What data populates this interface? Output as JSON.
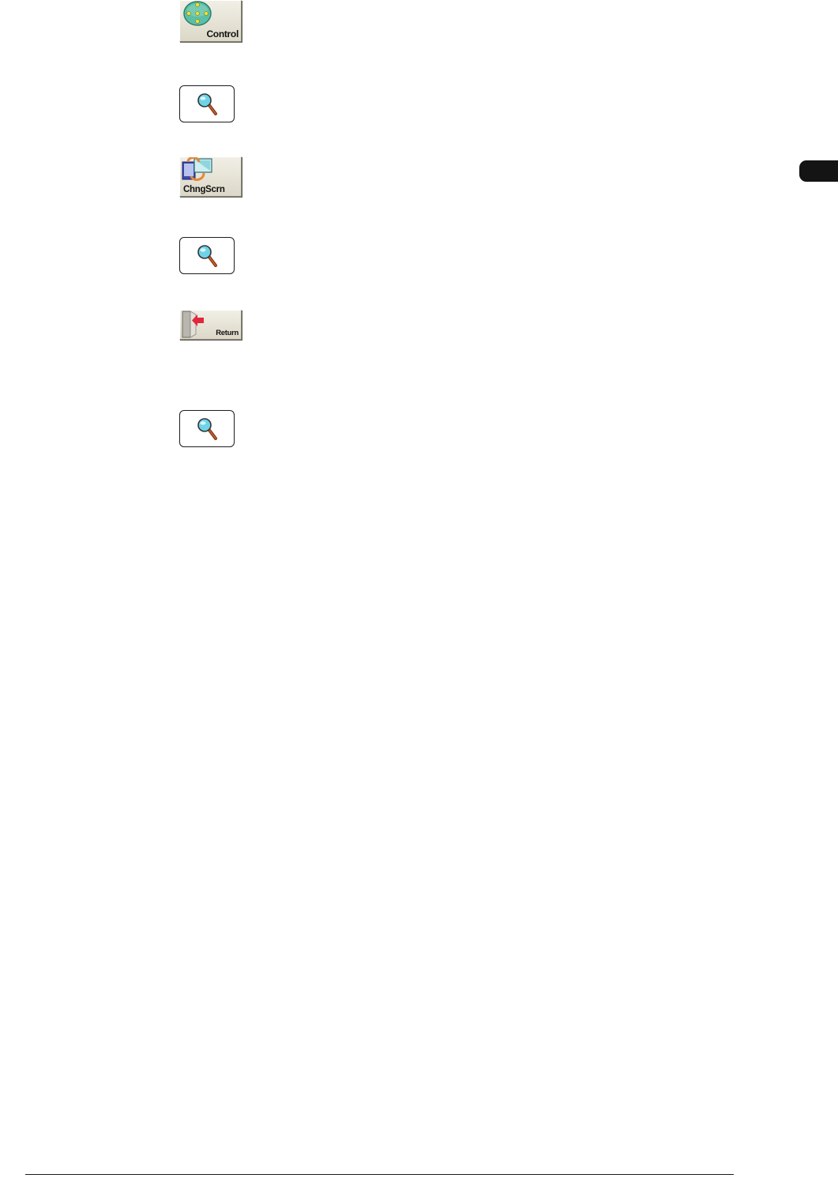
{
  "buttons": {
    "control": {
      "label": "Control",
      "icon": "control-pad-icon"
    },
    "chngscrn": {
      "label": "ChngScrn",
      "icon": "change-screen-icon"
    },
    "return": {
      "label": "Return",
      "icon": "return-arrow-icon"
    }
  },
  "zoom_buttons": [
    {
      "icon": "magnifier-icon"
    },
    {
      "icon": "magnifier-icon"
    },
    {
      "icon": "magnifier-icon"
    }
  ],
  "colors": {
    "button_face": "#e7e4d8",
    "control_pad": "#5bbfa6",
    "control_dots": "#f2e23a",
    "magnifier_lens": "#6fd3e8",
    "magnifier_handle": "#8a3a1a",
    "return_arrow": "#e0283c",
    "chapter_tab": "#141414"
  }
}
